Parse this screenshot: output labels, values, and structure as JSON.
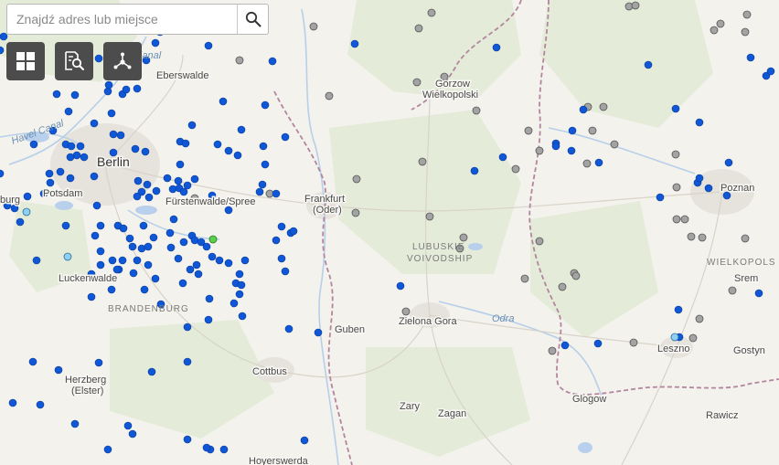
{
  "search": {
    "placeholder": "Znajdź adres lub miejsce"
  },
  "toolbar": [
    {
      "name": "basemap-gallery-button",
      "icon": "grid-icon"
    },
    {
      "name": "layer-search-button",
      "icon": "document-search-icon"
    },
    {
      "name": "share-button",
      "icon": "share-nodes-icon"
    }
  ],
  "map": {
    "labels": {
      "berlin": "Berlin",
      "potsdam": "Potsdam",
      "eberswalde": "Eberswalde",
      "fuerstenwalde": "Fürstenwalde/Spree",
      "frankfurt_1": "Frankfurt",
      "frankfurt_2": "(Oder)",
      "gorzow_1": "Gorzow",
      "gorzow_2": "Wielkopolski",
      "poznan": "Poznan",
      "lubuskie_1": "LUBUSKIE",
      "lubuskie_2": "VOIVODSHIP",
      "wielkopolska": "WIELKOPOLS",
      "srem": "Srem",
      "luckenwalde": "Luckenwalde",
      "brandenburg": "BRANDENBURG",
      "guben": "Guben",
      "zielona_gora": "Zielona Gora",
      "odra": "Odra",
      "leszno": "Leszno",
      "gostyn": "Gostyn",
      "herzberg_1": "Herzberg",
      "herzberg_2": "(Elster)",
      "cottbus": "Cottbus",
      "glogow": "Glogow",
      "zary": "Zary",
      "zagan": "Zagan",
      "rawicz": "Rawicz",
      "hoyerswerda": "Hoyerswerda",
      "havel_canal": "Havel Canal",
      "kanal": "l-Kanal",
      "brug": "burg"
    },
    "legend_colors": {
      "blue_point": "#0f57d6",
      "gray_point": "#a3a3a3",
      "light_blue_point": "#8fd0f2",
      "green_point": "#58d04a",
      "border": "#b3859f"
    }
  }
}
